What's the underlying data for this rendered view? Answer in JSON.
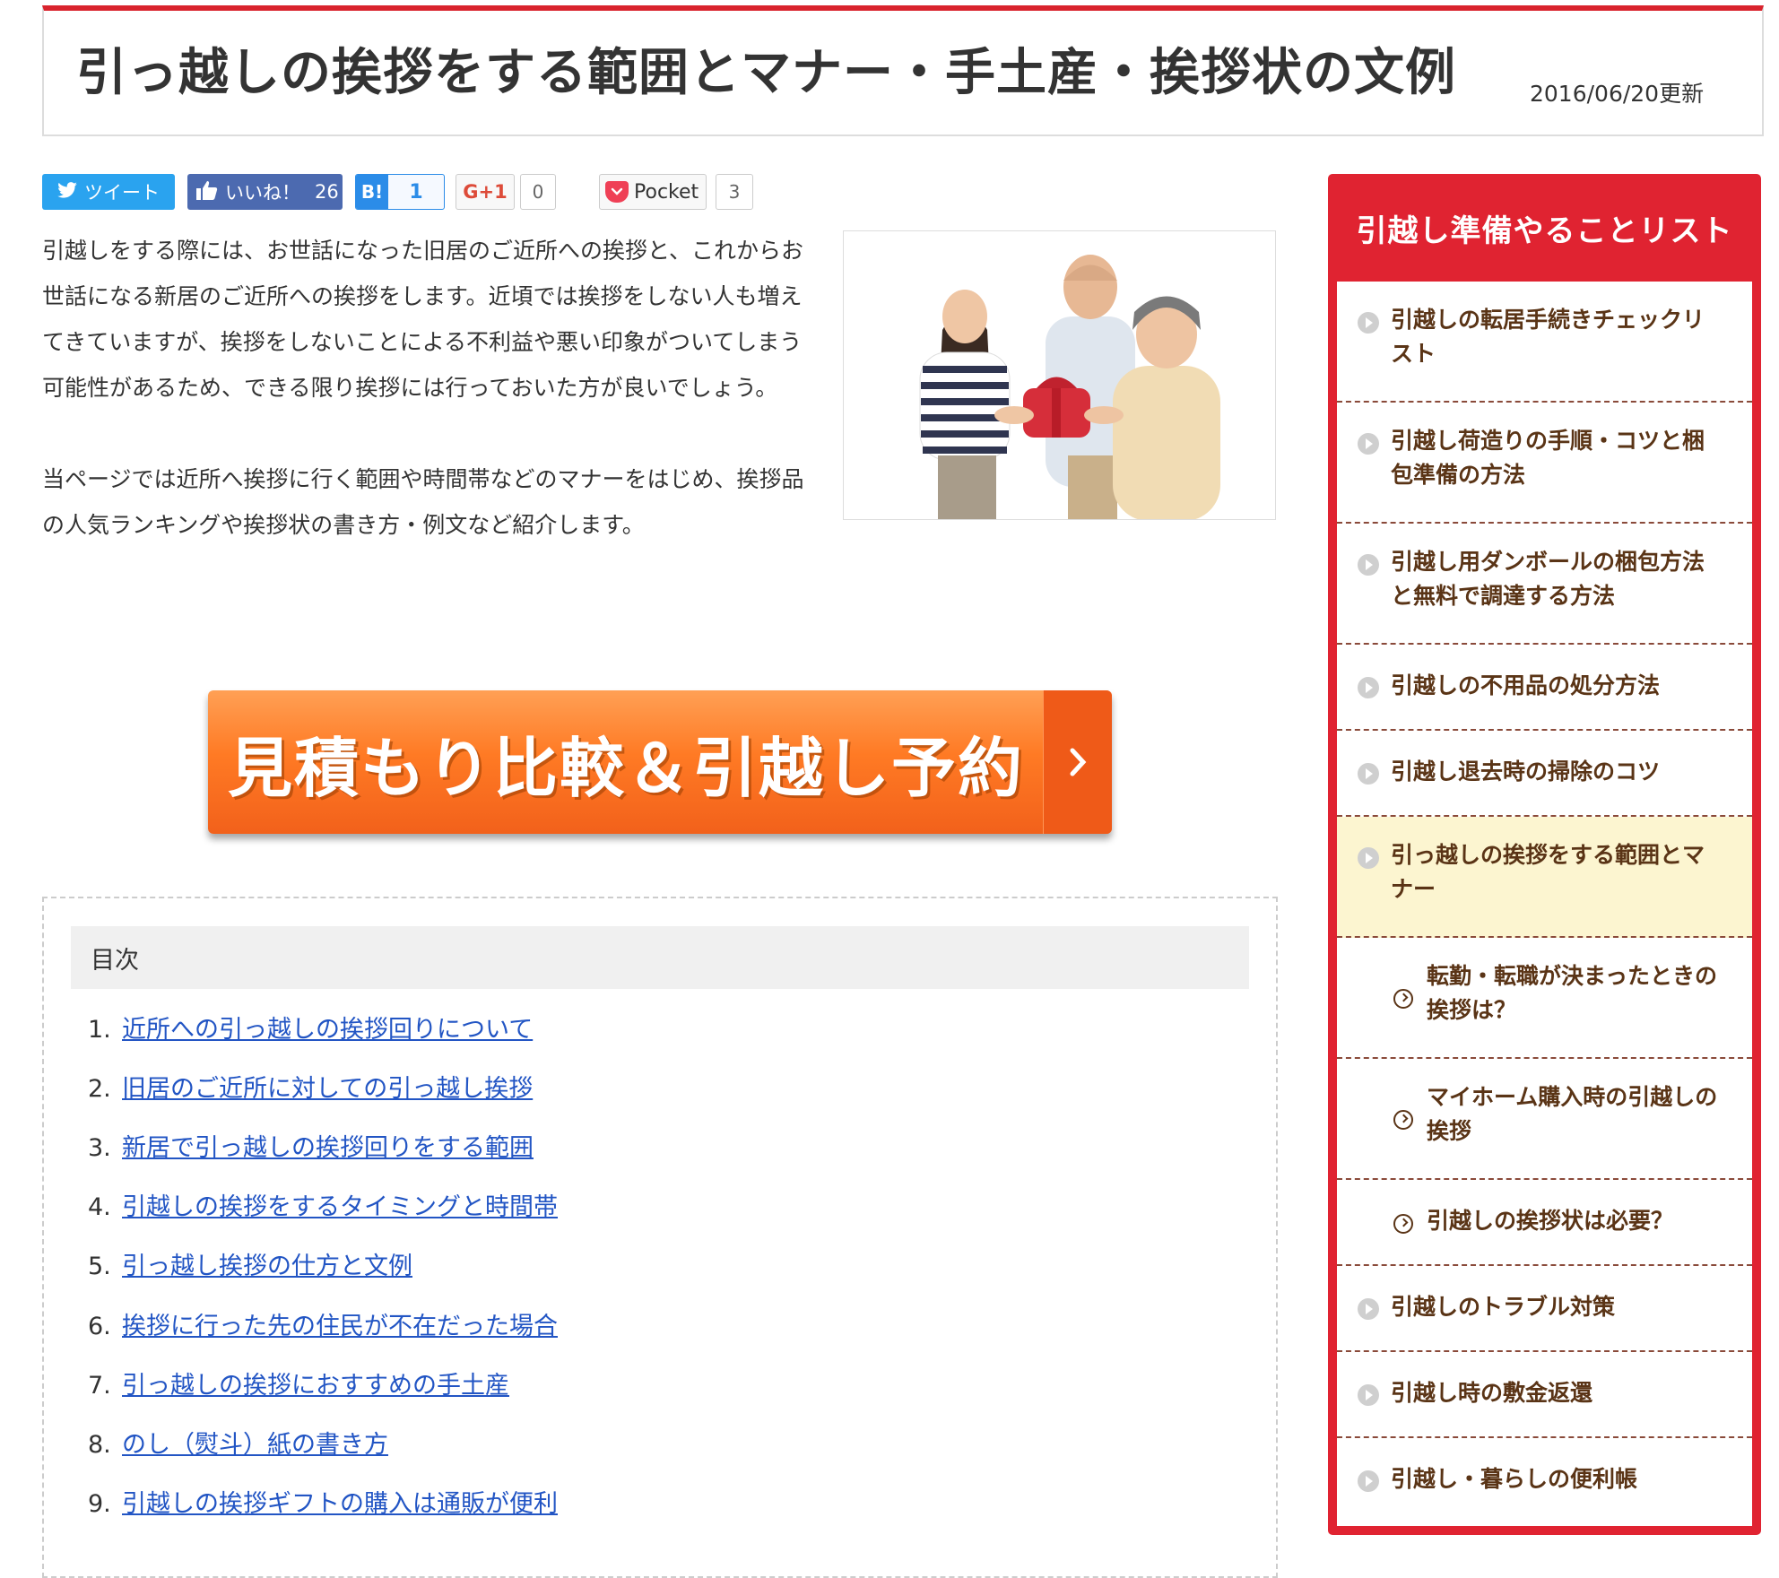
{
  "header": {
    "title": "引っ越しの挨拶をする範囲とマナー・手土産・挨拶状の文例",
    "updated": "2016/06/20更新"
  },
  "share": {
    "tweet_label": "ツイート",
    "like_label": "いいね！",
    "like_count": "26",
    "hatena_logo": "B!",
    "hatena_count": "1",
    "gplus_label": "G+1",
    "gplus_count": "0",
    "pocket_label": "Pocket",
    "pocket_count": "3"
  },
  "intro": {
    "paragraph1": "引越しをする際には、お世話になった旧居のご近所への挨拶と、これからお世話になる新居のご近所への挨拶をします。近頃では挨拶をしない人も増えてきていますが、挨拶をしないことによる不利益や悪い印象がついてしまう可能性があるため、できる限り挨拶には行っておいた方が良いでしょう。",
    "paragraph2": "当ページでは近所へ挨拶に行く範囲や時間帯などのマナーをはじめ、挨拶品の人気ランキングや挨拶状の書き方・例文など紹介します。"
  },
  "cta": {
    "label": "見積もり比較＆引越し予約",
    "arrow": "›"
  },
  "toc": {
    "title": "目次",
    "items": [
      {
        "num": "1.",
        "label": "近所への引っ越しの挨拶回りについて"
      },
      {
        "num": "2.",
        "label": "旧居のご近所に対しての引っ越し挨拶"
      },
      {
        "num": "3.",
        "label": "新居で引っ越しの挨拶回りをする範囲"
      },
      {
        "num": "4.",
        "label": "引越しの挨拶をするタイミングと時間帯"
      },
      {
        "num": "5.",
        "label": "引っ越し挨拶の仕方と文例"
      },
      {
        "num": "6.",
        "label": "挨拶に行った先の住民が不在だった場合"
      },
      {
        "num": "7.",
        "label": "引っ越しの挨拶におすすめの手土産"
      },
      {
        "num": "8.",
        "label": "のし（熨斗）紙の書き方"
      },
      {
        "num": "9.",
        "label": "引越しの挨拶ギフトの購入は通販が便利"
      }
    ]
  },
  "sidebar": {
    "title": "引越し準備やることリスト",
    "items": [
      {
        "label": "引越しの転居手続きチェックリスト",
        "level": 1,
        "active": false
      },
      {
        "label": "引越し荷造りの手順・コツと梱包準備の方法",
        "level": 1,
        "active": false
      },
      {
        "label": "引越し用ダンボールの梱包方法と無料で調達する方法",
        "level": 1,
        "active": false
      },
      {
        "label": "引越しの不用品の処分方法",
        "level": 1,
        "active": false
      },
      {
        "label": "引越し退去時の掃除のコツ",
        "level": 1,
        "active": false
      },
      {
        "label": "引っ越しの挨拶をする範囲とマナー",
        "level": 1,
        "active": true
      },
      {
        "label": "転勤・転職が決まったときの挨拶は？",
        "level": 2,
        "active": false
      },
      {
        "label": "マイホーム購入時の引越しの挨拶",
        "level": 2,
        "active": false
      },
      {
        "label": "引越しの挨拶状は必要？",
        "level": 2,
        "active": false
      },
      {
        "label": "引越しのトラブル対策",
        "level": 1,
        "active": false
      },
      {
        "label": "引越し時の敷金返還",
        "level": 1,
        "active": false
      },
      {
        "label": "引越し・暮らしの便利帳",
        "level": 1,
        "active": false
      }
    ]
  },
  "colors": {
    "accent_red": "#d9232d",
    "link_blue": "#2255c4",
    "cta_orange": "#ff7a24",
    "sidebar_text": "#5a3416",
    "active_bg": "#fcf5d0"
  }
}
